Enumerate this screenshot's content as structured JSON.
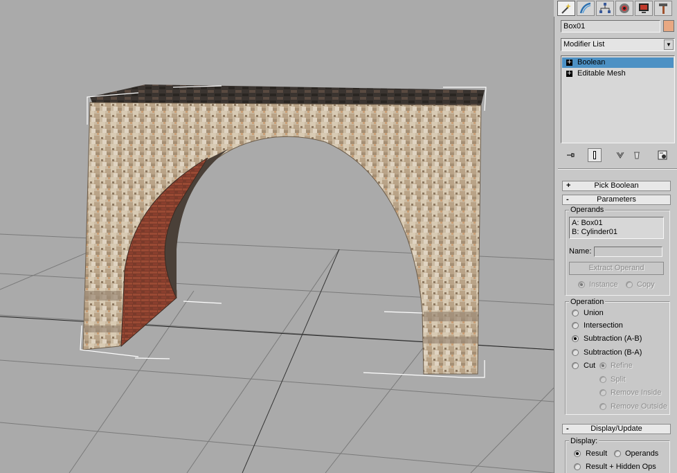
{
  "toolbar_tabs": [
    {
      "name": "create-tab",
      "icon": "magic-wand-icon",
      "active": true
    },
    {
      "name": "modify-tab",
      "icon": "modify-arc-icon",
      "active": false
    },
    {
      "name": "hierarchy-tab",
      "icon": "hierarchy-icon",
      "active": false
    },
    {
      "name": "motion-tab",
      "icon": "motion-icon",
      "active": false
    },
    {
      "name": "display-tab",
      "icon": "display-monitor-icon",
      "active": false
    },
    {
      "name": "utilities-tab",
      "icon": "hammer-icon",
      "active": false
    }
  ],
  "object": {
    "name": "Box01",
    "color": "#e8a882"
  },
  "modifier_list": {
    "label": "Modifier List"
  },
  "stack": {
    "items": [
      {
        "label": "Boolean",
        "selected": true
      },
      {
        "label": "Editable Mesh",
        "selected": false
      }
    ]
  },
  "rollouts": {
    "pick_boolean": {
      "sign": "+",
      "label": "Pick Boolean"
    },
    "parameters": {
      "sign": "-",
      "label": "Parameters"
    },
    "display_update": {
      "sign": "-",
      "label": "Display/Update"
    }
  },
  "operands": {
    "title": "Operands",
    "list": [
      "A: Box01",
      "B: Cylinder01"
    ],
    "name_label": "Name:",
    "name_value": "",
    "extract_label": "Extract Operand",
    "instance_label": "Instance",
    "copy_label": "Copy"
  },
  "operation": {
    "title": "Operation",
    "union": "Union",
    "intersection": "Intersection",
    "subtraction_ab": "Subtraction (A-B)",
    "subtraction_ba": "Subtraction (B-A)",
    "cut": "Cut",
    "refine": "Refine",
    "split": "Split",
    "remove_inside": "Remove Inside",
    "remove_outside": "Remove Outside",
    "selected": "Subtraction (A-B)"
  },
  "display": {
    "title": "Display:",
    "result": "Result",
    "operands": "Operands",
    "result_hidden": "Result + Hidden Ops",
    "selected": "Result"
  },
  "colors": {
    "viewport_bg": "#aaaaaa",
    "panel_bg": "#c8c8c8",
    "selection_blue": "#4d91c4"
  }
}
